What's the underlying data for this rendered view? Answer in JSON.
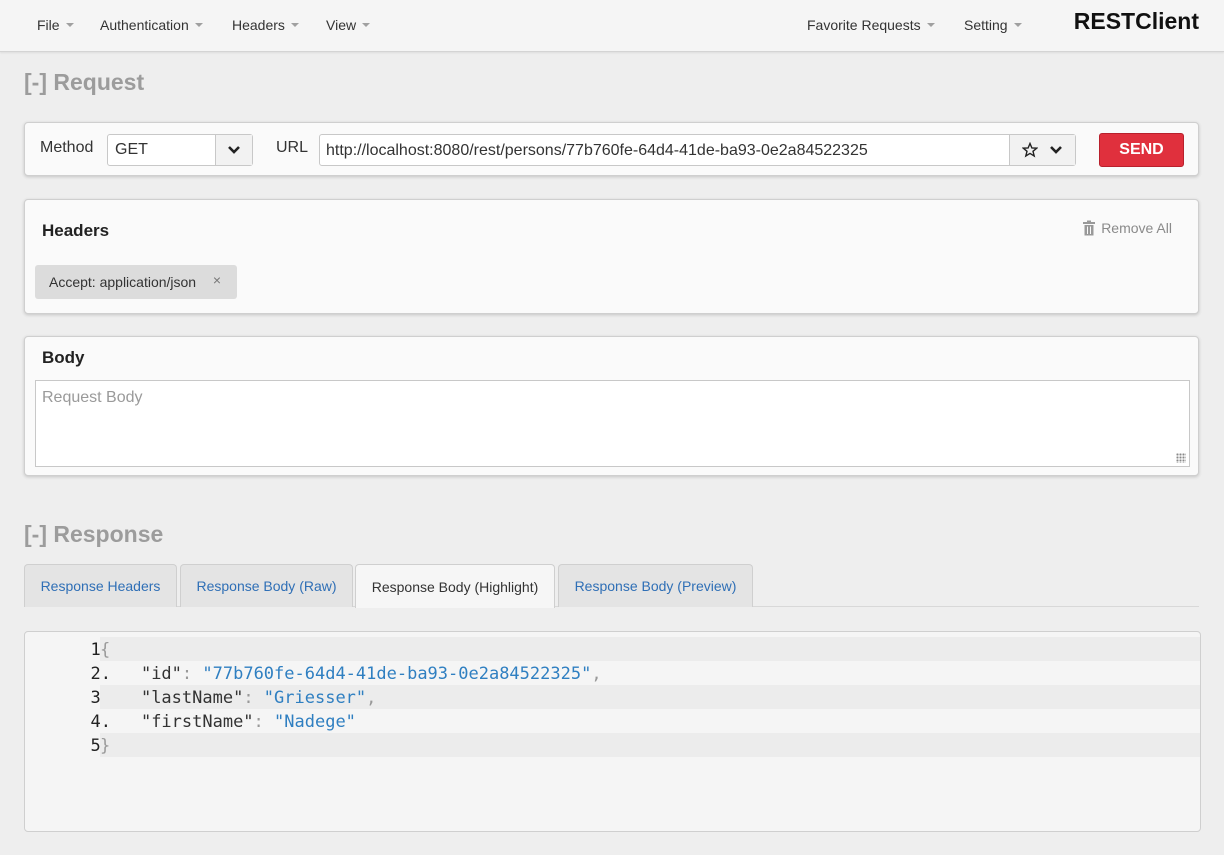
{
  "nav": {
    "menu_left": [
      "File",
      "Authentication",
      "Headers",
      "View"
    ],
    "menu_right": [
      "Favorite Requests",
      "Setting"
    ],
    "brand": "RESTClient"
  },
  "request": {
    "section_title": "[-] Request",
    "method_label": "Method",
    "method_value": "GET",
    "url_label": "URL",
    "url_value": "http://localhost:8080/rest/persons/77b760fe-64d4-41de-ba93-0e2a84522325",
    "send_label": "SEND"
  },
  "headers_panel": {
    "title": "Headers",
    "remove_all": "Remove All",
    "tags": [
      "Accept: application/json"
    ],
    "tag_close": "×"
  },
  "body_panel": {
    "title": "Body",
    "placeholder": "Request Body"
  },
  "response": {
    "section_title": "[-] Response",
    "tabs": [
      "Response Headers",
      "Response Body (Raw)",
      "Response Body (Highlight)",
      "Response Body (Preview)"
    ],
    "active_tab": "Response Body (Highlight)",
    "line_numbers": [
      "1.",
      "2.",
      "3.",
      "4.",
      "5."
    ],
    "json": {
      "open": "{",
      "id_key": "\"id\"",
      "id_value": "\"77b760fe-64d4-41de-ba93-0e2a84522325\"",
      "last_key": "\"lastName\"",
      "last_value": "\"Griesser\"",
      "first_key": "\"firstName\"",
      "first_value": "\"Nadege\"",
      "colon": ": ",
      "comma": ",",
      "close": "}"
    }
  },
  "icons": {
    "dropdown": "chevron-down-icon",
    "favorite": "star-icon",
    "trash": "trash-icon",
    "close": "close-icon"
  },
  "colors": {
    "send_button": "#e0303d",
    "link_tab": "#2f6fb6",
    "json_string": "#2f7fc1",
    "section_title": "#9c9c9c"
  }
}
